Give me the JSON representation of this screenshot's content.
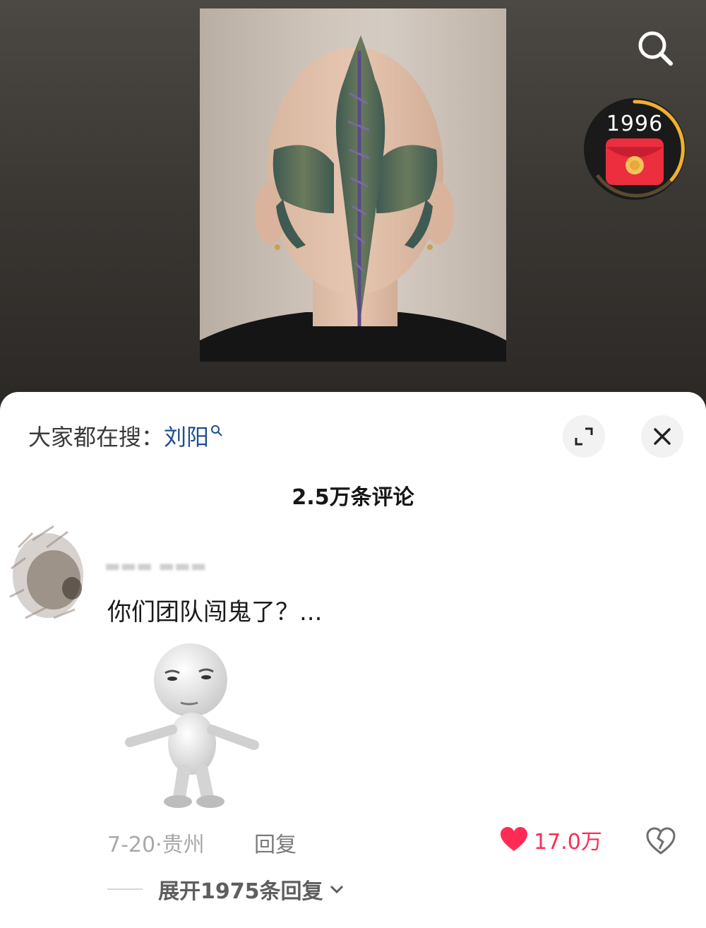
{
  "video": {
    "redpacket_count": "1996"
  },
  "comments_panel": {
    "trending_prefix": "大家都在搜：",
    "trending_query": "刘阳",
    "title": "2.5万条评论",
    "comment": {
      "text": "你们团队闯鬼了？...",
      "date_location": "7-20·贵州",
      "reply_label": "回复",
      "like_count": "17.0万",
      "expand_replies_label": "展开1975条回复"
    }
  },
  "colors": {
    "accent_like": "#fe2c55",
    "trending_link": "#1f4e8c",
    "redpacket": "#ec2e3e"
  },
  "icons": [
    "search-icon",
    "red-packet-icon",
    "expand-icon",
    "close-icon",
    "heart-icon",
    "heart-broken-icon",
    "chevron-down-icon"
  ]
}
